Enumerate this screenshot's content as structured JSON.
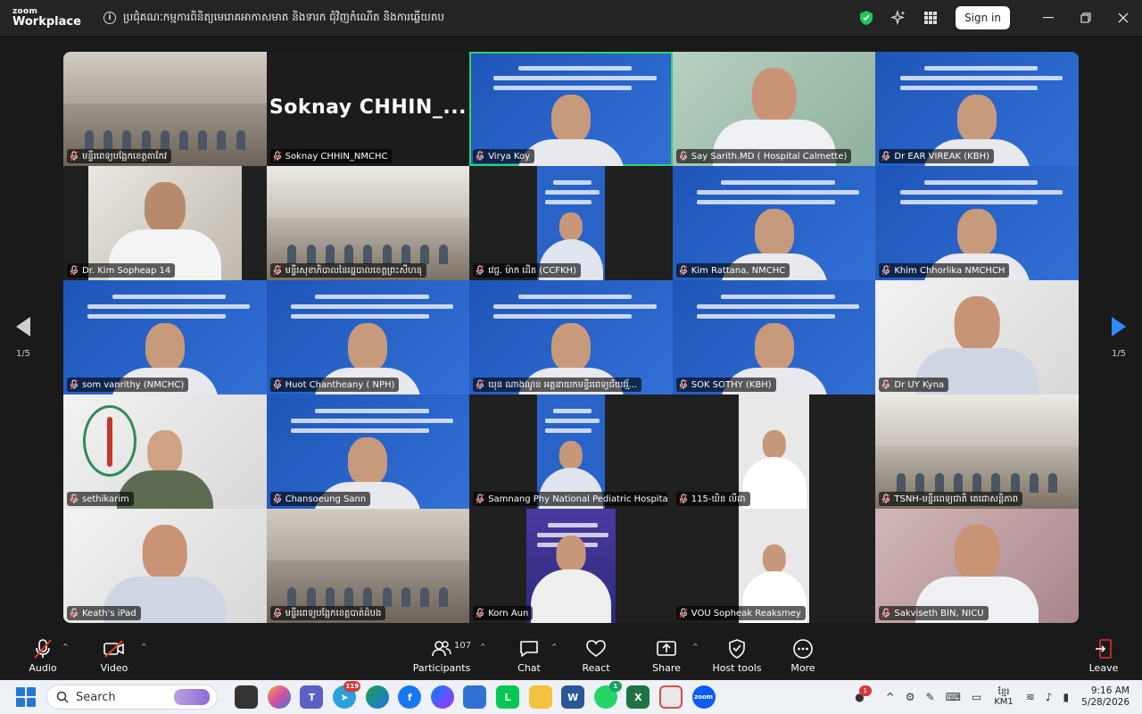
{
  "app": {
    "brand_top": "zoom",
    "brand_bottom": "Workplace",
    "meeting_title": "ប្រជុំគណៈកម្មការពិនិត្យមេរោគអាកាសមាត និងទារក ជុំវិញកំណើត និងការឆ្លើយតប",
    "sign_in": "Sign in"
  },
  "pagination": {
    "left": "1/5",
    "right": "1/5"
  },
  "tiles": [
    {
      "name": "មន្ទីរពេទ្យបង្អែកខេត្តតាកែវ",
      "bg": "bg-room",
      "kind": "room"
    },
    {
      "name": "Soknay CHHIN_NMCHC",
      "bg": "bg-black",
      "kind": "name-only",
      "big": "Soknay  CHHIN_..."
    },
    {
      "name": "Virya Koy",
      "bg": "bg-blue",
      "kind": "banner",
      "active": true
    },
    {
      "name": "Say Sarith.MD ( Hospital Calmette)",
      "bg": "bg-green",
      "kind": "person"
    },
    {
      "name": "Dr EAR VIREAK (KBH)",
      "bg": "bg-blue",
      "kind": "banner"
    },
    {
      "name": "Dr. Kim Sopheap 14",
      "bg": "bg-dark",
      "kind": "person-inset"
    },
    {
      "name": "មន្ទីរសុខាភិបាលនៃរដ្ឋបាលខេត្តព្រះសីហនុ",
      "bg": "bg-room2",
      "kind": "room"
    },
    {
      "name": "វេជ្ជ. ម៉ាក ដើត (CCFKH)",
      "bg": "bg-dark",
      "kind": "banner-inset"
    },
    {
      "name": "Kim Rattana, NMCHC",
      "bg": "bg-blue",
      "kind": "banner"
    },
    {
      "name": "Khim Chhorlika NMCHCH",
      "bg": "bg-blue",
      "kind": "banner"
    },
    {
      "name": "som vanrithy (NMCHC)",
      "bg": "bg-blue",
      "kind": "banner"
    },
    {
      "name": "Huot Chantheany ( NPH)",
      "bg": "bg-blue",
      "kind": "banner"
    },
    {
      "name": "ឃុន ណាងណូន អគ្គនាយកមន្ទីរពេទ្យជ័យវរ្ម័...",
      "bg": "bg-blue",
      "kind": "banner"
    },
    {
      "name": "SOK SOTHY (KBH)",
      "bg": "bg-blue",
      "kind": "banner"
    },
    {
      "name": "Dr UY Kyna",
      "bg": "bg-white",
      "kind": "person"
    },
    {
      "name": "sethikarim",
      "bg": "bg-white",
      "kind": "emblem"
    },
    {
      "name": "Chansoeung Sann",
      "bg": "bg-blue",
      "kind": "banner"
    },
    {
      "name": "Samnang Phy National Pediatric Hospital",
      "bg": "bg-dark",
      "kind": "banner-inset"
    },
    {
      "name": "115-ឃិន លីដា",
      "bg": "bg-dark",
      "kind": "person-inset-white"
    },
    {
      "name": "TSNH-មន្ទីរពេទ្យជាតិ តេជោសន្តិភាព",
      "bg": "bg-room2",
      "kind": "room"
    },
    {
      "name": "Keath's iPad",
      "bg": "bg-white",
      "kind": "person"
    },
    {
      "name": "មន្ទីរពេទ្យបង្អែកខេត្តបាត់ដំបង",
      "bg": "bg-room",
      "kind": "room"
    },
    {
      "name": "Korn Aun",
      "bg": "bg-dark",
      "kind": "banner-inset-purple"
    },
    {
      "name": "VOU Sopheak Reaksmey",
      "bg": "bg-dark",
      "kind": "person-inset-white"
    },
    {
      "name": "Sakviseth BIN, NICU",
      "bg": "bg-pink",
      "kind": "person"
    }
  ],
  "toolbar": {
    "audio": "Audio",
    "video": "Video",
    "participants": "Participants",
    "participants_count": "107",
    "chat": "Chat",
    "react": "React",
    "share": "Share",
    "host_tools": "Host tools",
    "more": "More",
    "leave": "Leave"
  },
  "taskbar": {
    "search": "Search",
    "telegram_badge": "119",
    "whatsapp_badge": "1",
    "tray_badge": "1",
    "lang_top": "ខ្មែរ",
    "lang_bottom": "KM1",
    "time": "9:16 AM",
    "date": "5/28/2026"
  },
  "colors": {
    "active_speaker": "#2bd46b",
    "mic_muted": "#e53935",
    "banner_blue": "#2a63c8",
    "leave_red": "#e02f2f"
  }
}
